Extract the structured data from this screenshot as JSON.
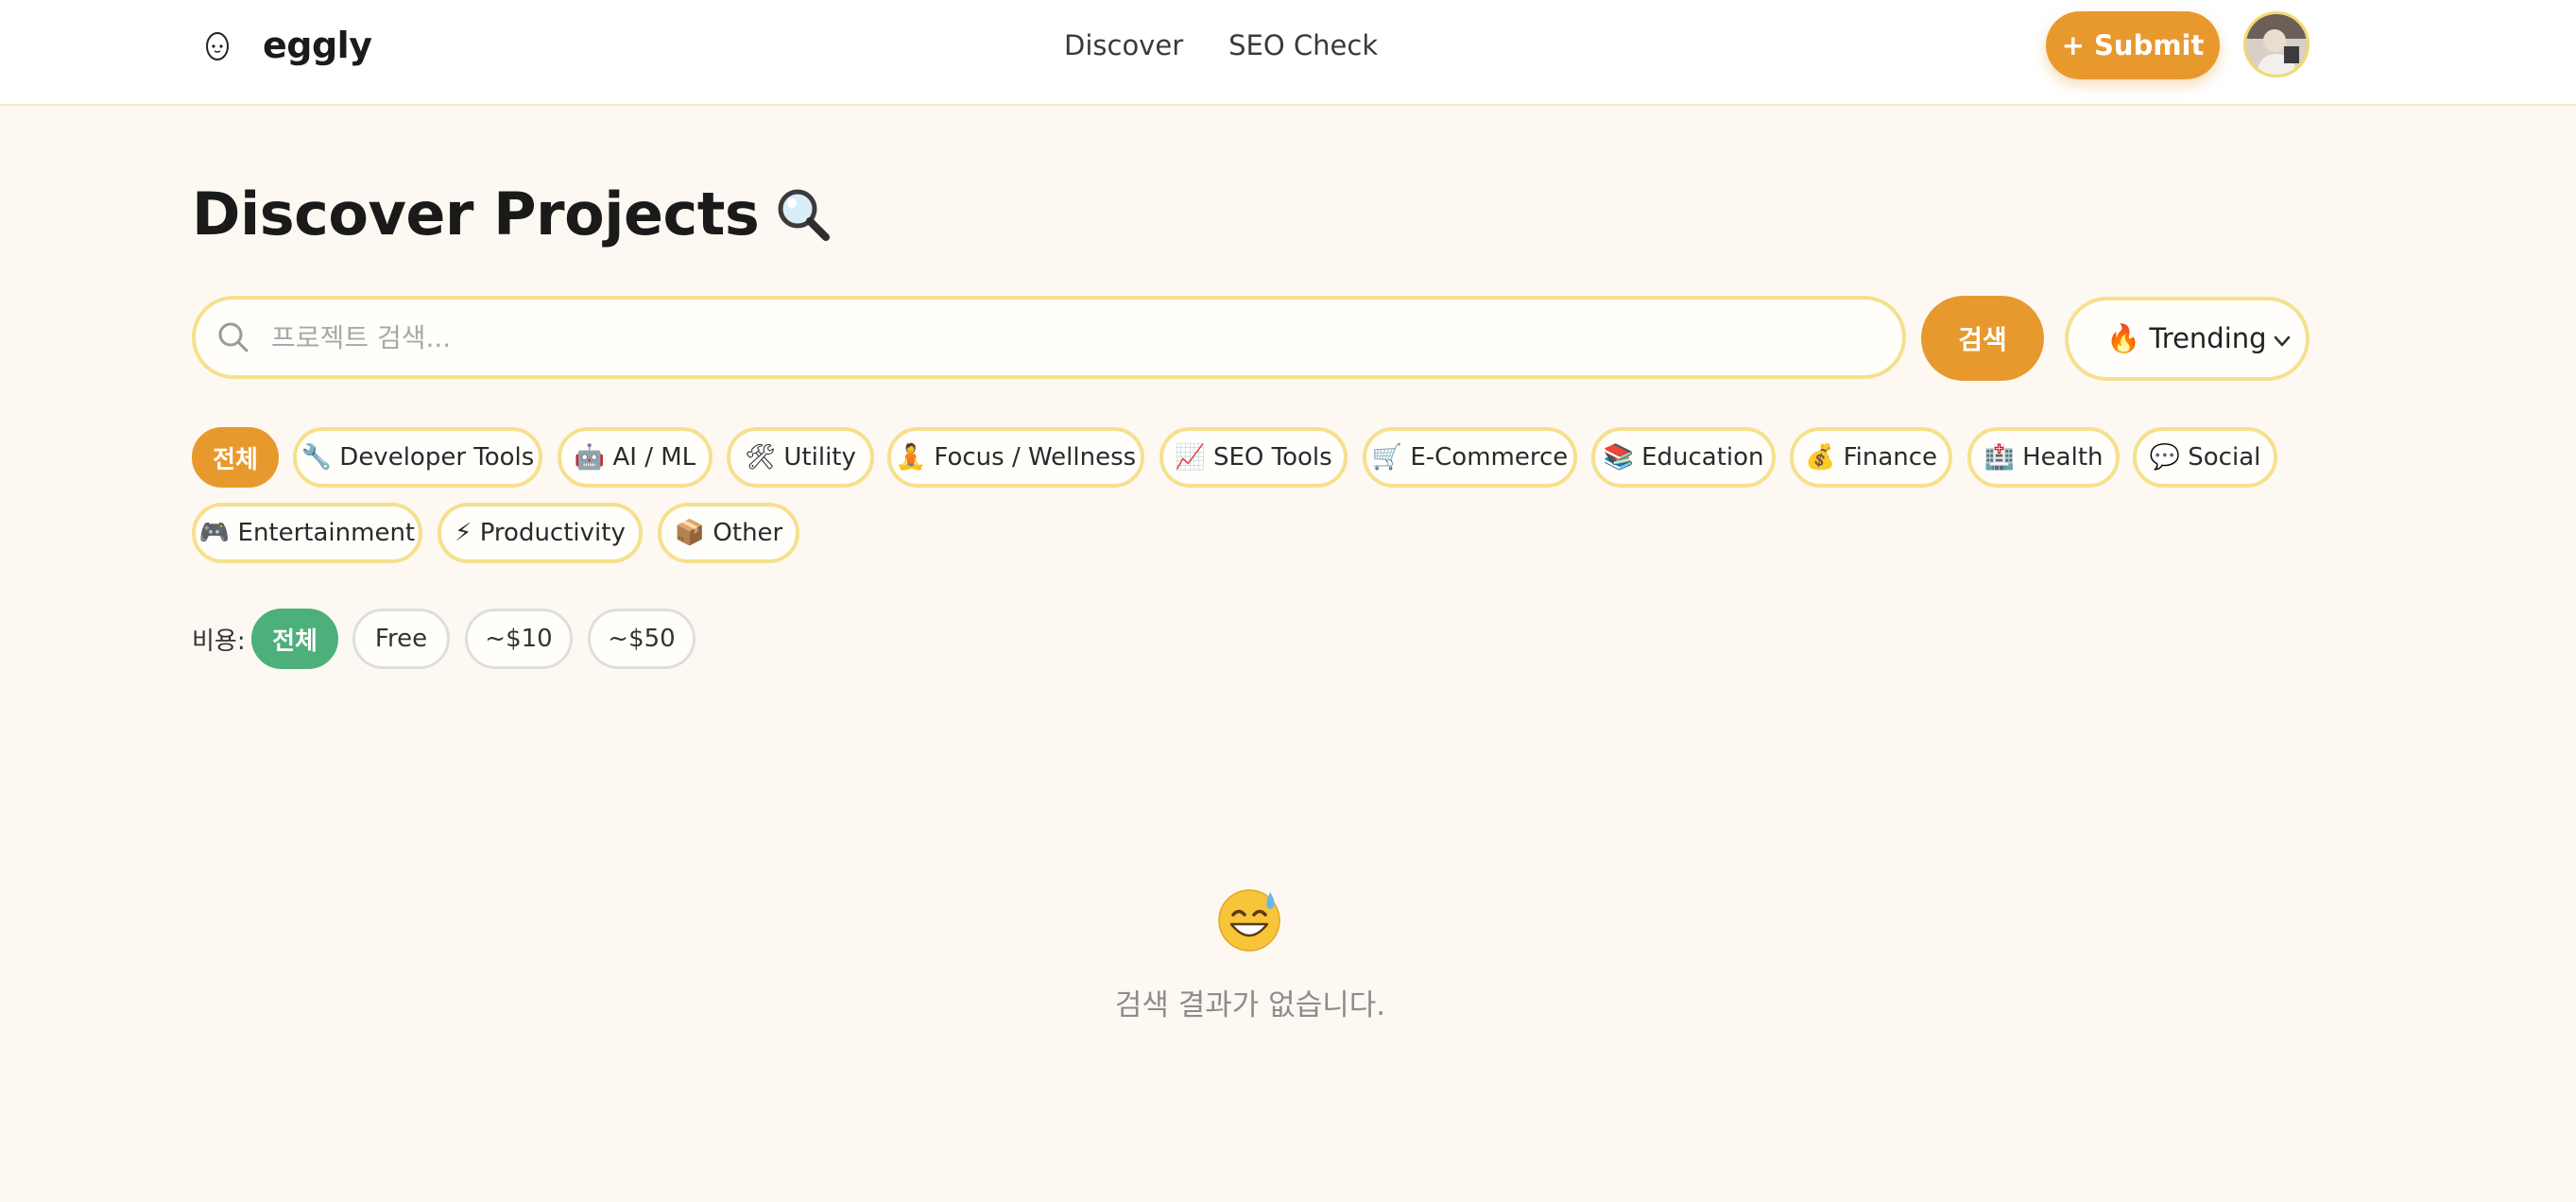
{
  "header": {
    "brand": "eggly",
    "nav": [
      "Discover",
      "SEO Check"
    ],
    "submit_label": "+ Submit",
    "avatar_icon": "user-avatar"
  },
  "page": {
    "title": "Discover Projects",
    "title_icon": "magnifier-icon"
  },
  "search": {
    "placeholder": "프로젝트 검색...",
    "value": "",
    "button_label": "검색"
  },
  "sort": {
    "selected": "🔥 Trending"
  },
  "categories": [
    {
      "label": "전체",
      "active": true
    },
    {
      "label": "🔧 Developer Tools"
    },
    {
      "label": "🤖 AI / ML"
    },
    {
      "label": "🛠 Utility"
    },
    {
      "label": "🧘 Focus / Wellness"
    },
    {
      "label": "📈 SEO Tools"
    },
    {
      "label": "🛒 E-Commerce"
    },
    {
      "label": "📚 Education"
    },
    {
      "label": "💰 Finance"
    },
    {
      "label": "🏥 Health"
    },
    {
      "label": "💬 Social"
    },
    {
      "label": "🎮 Entertainment"
    },
    {
      "label": "⚡ Productivity"
    },
    {
      "label": "📦 Other"
    }
  ],
  "price_filter": {
    "label": "비용:",
    "options": [
      {
        "label": "전체",
        "active": true
      },
      {
        "label": "Free"
      },
      {
        "label": "~$10"
      },
      {
        "label": "~$50"
      }
    ]
  },
  "empty_state": {
    "icon": "sweat-smile-emoji",
    "message": "검색 결과가 없습니다."
  },
  "colors": {
    "accent": "#e8992e",
    "chip_border": "#f6e08e",
    "price_active": "#4db07a",
    "background": "#fdf9f2"
  }
}
